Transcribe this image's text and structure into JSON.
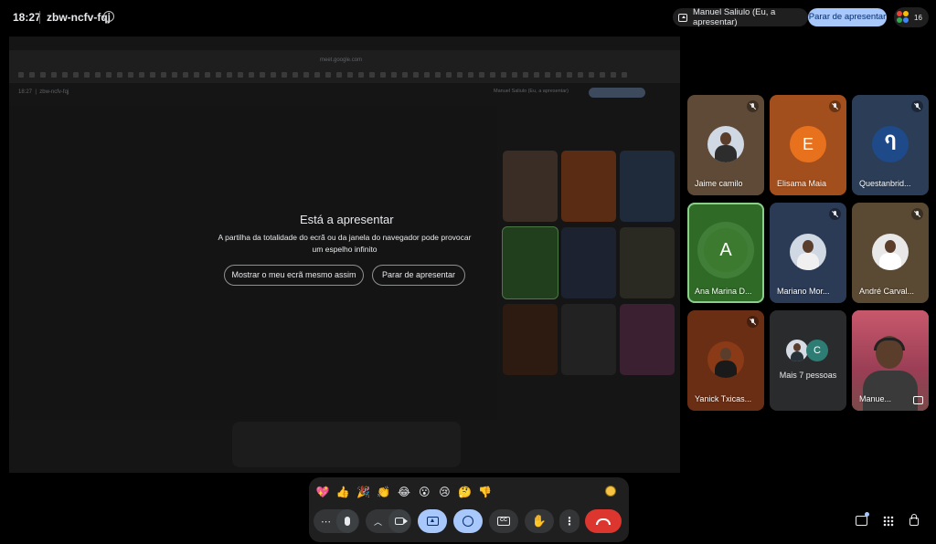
{
  "meeting": {
    "time": "18:27",
    "code": "zbw-ncfv-fqj"
  },
  "presenting": {
    "label": "Manuel Saliulo (Eu, a apresentar)",
    "stop_label": "Parar de apresentar"
  },
  "people_count": "16",
  "mirror": {
    "url": "meet.google.com",
    "time": "18:27",
    "code": "zbw-ncfv-fqj",
    "presenting_label": "Manuel Saliulo (Eu, a apresentar)"
  },
  "dialog": {
    "title": "Está a apresentar",
    "text": "A partilha da totalidade do ecrã ou da janela do navegador pode provocar um espelho infinito",
    "show_label": "Mostrar o meu ecrã mesmo assim",
    "stop_label": "Parar de apresentar"
  },
  "participants": [
    {
      "name": "Jaime camilo",
      "type": "photo",
      "muted": true
    },
    {
      "name": "Elisama Maia",
      "type": "initial",
      "initial": "E",
      "color": "#e8711e",
      "bg": "#b8561d",
      "muted": true
    },
    {
      "name": "Questanbrid...",
      "type": "logo",
      "muted": true
    },
    {
      "name": "Ana Marina D...",
      "type": "initial",
      "initial": "A",
      "color": "#3b7a2f",
      "bg": "#2f6a27",
      "muted": false,
      "pinned": true
    },
    {
      "name": "Mariano Mor...",
      "type": "photo",
      "muted": true
    },
    {
      "name": "André Carval...",
      "type": "photo",
      "muted": true
    },
    {
      "name": "Yanick Txicas...",
      "type": "photo",
      "muted": true
    },
    {
      "name": "Mais 7 pessoas",
      "type": "more",
      "initial": "C"
    },
    {
      "name": "Manue...",
      "type": "self"
    }
  ],
  "reactions": [
    "💖",
    "👍",
    "🎉",
    "👏",
    "😂",
    "😮",
    "😢",
    "🤔",
    "👎"
  ],
  "toolbar": {
    "more_options": "⋯",
    "cc_label": "CC"
  },
  "colors": {
    "accent": "#a8c7fa",
    "end_call": "#dc362e",
    "pinned_outline": "#8ad08a"
  }
}
